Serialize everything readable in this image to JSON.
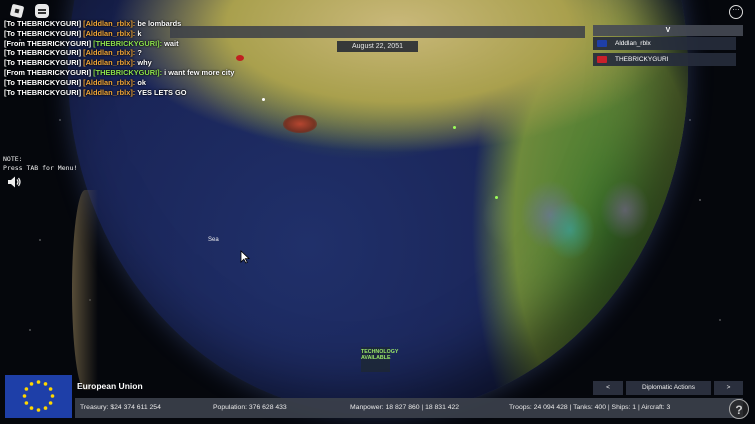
{
  "game_date": "August 22, 2051",
  "chat": [
    {
      "prefix": "[To THEBRICKYGURI]",
      "speaker": "[Alddlan_rblx]:",
      "speaker_color": "orange",
      "message": "be lombards"
    },
    {
      "prefix": "[To THEBRICKYGURI]",
      "speaker": "[Alddlan_rblx]:",
      "speaker_color": "orange",
      "message": "k"
    },
    {
      "prefix": "[From THEBRICKYGURI]",
      "speaker": "[THEBRICKYGURI]:",
      "speaker_color": "green",
      "message": "wait"
    },
    {
      "prefix": "[To THEBRICKYGURI]",
      "speaker": "[Alddlan_rblx]:",
      "speaker_color": "orange",
      "message": "?"
    },
    {
      "prefix": "[To THEBRICKYGURI]",
      "speaker": "[Alddlan_rblx]:",
      "speaker_color": "orange",
      "message": "why"
    },
    {
      "prefix": "[From THEBRICKYGURI]",
      "speaker": "[THEBRICKYGURI]:",
      "speaker_color": "green",
      "message": "i want few more city"
    },
    {
      "prefix": "[To THEBRICKYGURI]",
      "speaker": "[Alddlan_rblx]:",
      "speaker_color": "orange",
      "message": "ok"
    },
    {
      "prefix": "[To THEBRICKYGURI]",
      "speaker": "[Alddlan_rblx]:",
      "speaker_color": "orange",
      "message": "YES LETS GO"
    }
  ],
  "note": {
    "line1": "NOTE:",
    "line2": "Press TAB for Menu!"
  },
  "player_list": {
    "header": "V",
    "players": [
      {
        "name": "Alddlan_rblx",
        "flag_color": "#1e3fa8"
      },
      {
        "name": "THEBRICKYGURI",
        "flag_color": "#c8202a"
      }
    ]
  },
  "map": {
    "sea_label": "Sea",
    "tech_alert": "TECHNOLOGY AVAILABLE"
  },
  "country": {
    "name": "European Union"
  },
  "diplomacy": {
    "prev_label": "<",
    "label": "Diplomatic Actions",
    "next_label": ">"
  },
  "stats": {
    "treasury": "Treasury:  $24 374 611 254",
    "population": "Population: 376 628 433",
    "manpower": "Manpower:  18 827 860  |  18 831 422",
    "military": "Troops: 24 094 428  |  Tanks: 400  |  Ships: 1  |  Aircraft: 3"
  },
  "colors": {
    "chat_orange": "#f0a63a",
    "chat_green": "#8de24e",
    "ui_panel": "#3a404a",
    "eu_blue": "#1e3fa8",
    "eu_star": "#ffd700"
  },
  "icons": [
    "roblox-logo-icon",
    "chat-icon",
    "menu-icon",
    "speaker-icon",
    "mouse-cursor-icon",
    "help-icon"
  ]
}
